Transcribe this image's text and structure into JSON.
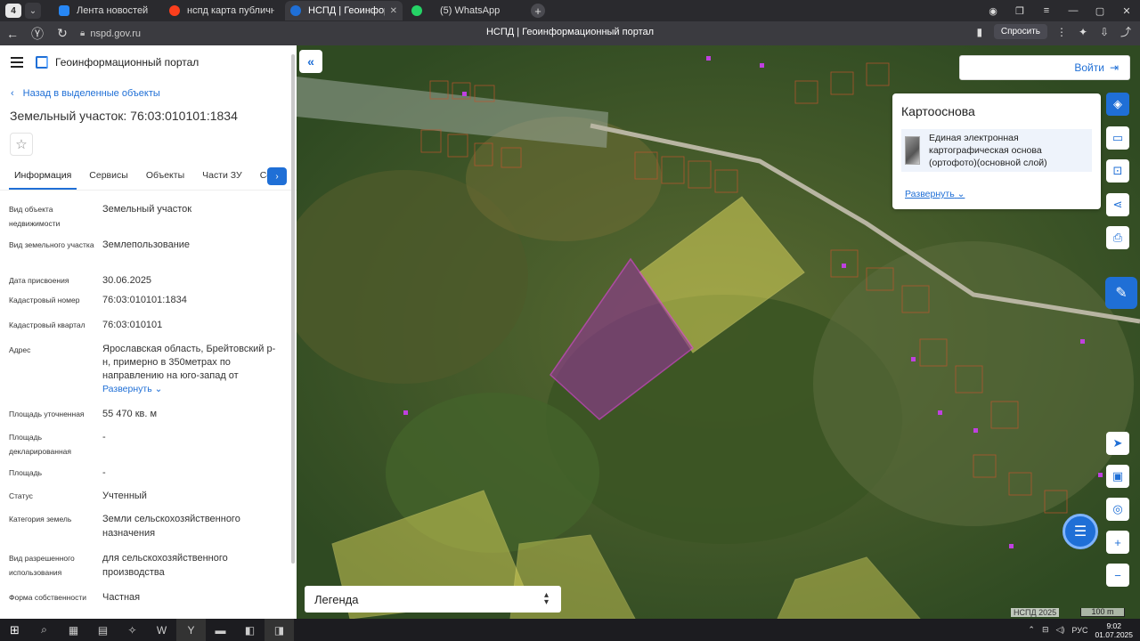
{
  "browser": {
    "tab_count": "4",
    "tabs": [
      {
        "title": "Лента новостей",
        "color": "#2787f5"
      },
      {
        "title": "нспд карта публичная кад",
        "color": "#fc3f1d"
      },
      {
        "title": "НСПД | Геоинформацио",
        "color": "#1f6fd6"
      },
      {
        "title": "(5) WhatsApp",
        "color": "#25d366"
      }
    ],
    "url": "nspd.gov.ru",
    "page_title": "НСПД | Геоинформационный портал",
    "ask_label": "Спросить"
  },
  "panel": {
    "app_title": "Геоинформационный портал",
    "back_label": "Назад в выделенные объекты",
    "parcel_title": "Земельный участок: 76:03:010101:1834",
    "tabs": [
      "Информация",
      "Сервисы",
      "Объекты",
      "Части ЗУ",
      "Соста"
    ],
    "rows": [
      {
        "k": "Вид объекта недвижимости",
        "v": "Земельный участок"
      },
      {
        "k": "Вид земельного участка",
        "v": "Землепользование"
      },
      {
        "k": "Дата присвоения",
        "v": "30.06.2025"
      },
      {
        "k": "Кадастровый номер",
        "v": "76:03:010101:1834"
      },
      {
        "k": "Кадастровый квартал",
        "v": "76:03:010101"
      },
      {
        "k": "Адрес",
        "v": "Ярославская область, Брейтовский р-н, примерно в 350метрах по направлению на юго-запад от"
      },
      {
        "k": "Площадь уточненная",
        "v": "55 470 кв. м"
      },
      {
        "k": "Площадь декларированная",
        "v": "-"
      },
      {
        "k": "Площадь",
        "v": "-"
      },
      {
        "k": "Статус",
        "v": "Учтенный"
      },
      {
        "k": "Категория земель",
        "v": "Земли сельскохозяйственного назначения"
      },
      {
        "k": "Вид разрешенного использования",
        "v": "для сельскохозяйственного производства"
      },
      {
        "k": "Форма собственности",
        "v": "Частная"
      }
    ],
    "address_expand": "Развернуть"
  },
  "map": {
    "login_label": "Войти",
    "basemap": {
      "title": "Картооснова",
      "layer_name": "Единая электронная картографическая основа (ортофото)(основной слой)",
      "expand_label": "Развернуть"
    },
    "legend_label": "Легенда",
    "copyright": "НСПД 2025",
    "scale": "100 m"
  },
  "taskbar": {
    "lang": "РУС",
    "time": "9:02",
    "date": "01.07.2025"
  }
}
